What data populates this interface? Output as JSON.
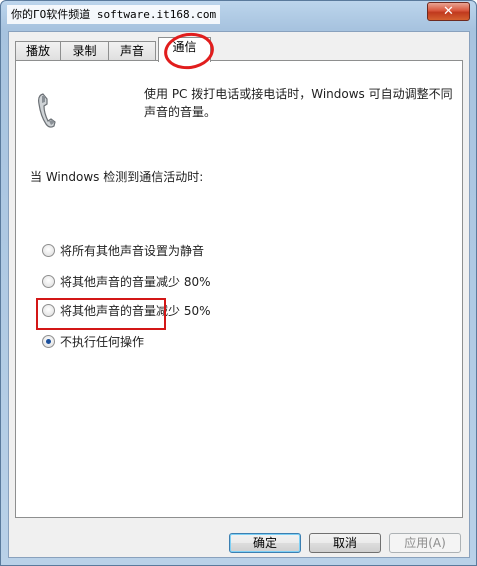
{
  "window": {
    "title": "你的ΓΟ软件频道 software.it168.com",
    "close_glyph": "✕"
  },
  "tabs": [
    {
      "label": "播放",
      "active": false
    },
    {
      "label": "录制",
      "active": false
    },
    {
      "label": "声音",
      "active": false
    },
    {
      "label": "通信",
      "active": true
    }
  ],
  "panel": {
    "icon": "telephone-handset-icon",
    "description": "使用 PC 拨打电话或接电话时，Windows 可自动调整不同声音的音量。",
    "section_label": "当 Windows 检测到通信活动时:",
    "options": [
      {
        "label": "将所有其他声音设置为静音",
        "checked": false
      },
      {
        "label": "将其他声音的音量减少 80%",
        "checked": false
      },
      {
        "label": "将其他声音的音量减少 50%",
        "checked": false
      },
      {
        "label": "不执行任何操作",
        "checked": true
      }
    ]
  },
  "buttons": {
    "ok": "确定",
    "cancel": "取消",
    "apply": "应用(A)"
  },
  "colors": {
    "annotation_red": "#d31717",
    "radio_dot": "#1a4f9c"
  }
}
